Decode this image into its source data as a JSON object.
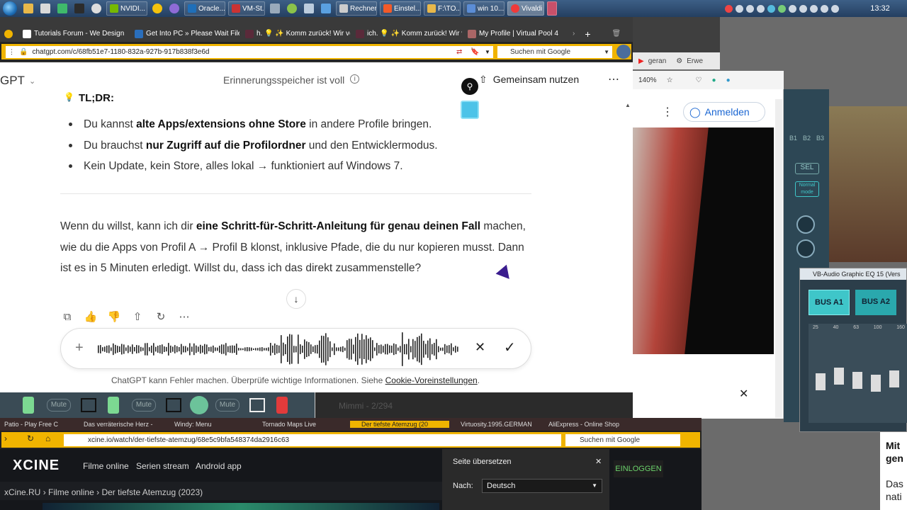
{
  "taskbar": {
    "tasks": [
      "NVIDI...",
      "Oracle...",
      "VM-St...",
      "Rechner",
      "Einstel...",
      "F:\\TO...",
      "win 10...",
      "Vivaldi"
    ],
    "clock": "13:32"
  },
  "main_tabs": [
    "Tutorials Forum - We Design",
    "Get Into PC » Please Wait File",
    "h. 💡 ✨ Komm zurück! Wir ver",
    "ich. 💡 ✨ Komm zurück! Wir v",
    "My Profile | Virtual Pool 4"
  ],
  "address": {
    "url": "chatgpt.com/c/68fb51e7-1180-832a-927b-917b838f3e6d",
    "search_placeholder": "Suchen mit Google"
  },
  "chat": {
    "model": "GPT",
    "memory_notice": "Erinnerungsspeicher ist voll",
    "share_label": "Gemeinsam nutzen",
    "tldr": "TL;DR:",
    "bullets": [
      {
        "pre": "Du kannst ",
        "bold": "alte Apps/extensions ohne Store",
        "post": " in andere Profile bringen."
      },
      {
        "pre": "Du brauchst ",
        "bold": "nur Zugriff auf die Profilordner",
        "post": " und den Entwicklermodus."
      },
      {
        "pre": "Kein Update, kein Store, alles lokal → funktioniert auf Windows 7.",
        "bold": "",
        "post": ""
      }
    ],
    "para_pre": "Wenn du willst, kann ich dir ",
    "para_bold": "eine Schritt-für-Schritt-Anleitung für genau deinen Fall",
    "para_post": " machen, wie du die Apps von Profil A → Profil B klonst, inklusive Pfade, die du nur kopieren musst. Dann ist es in 5 Minuten erledigt. Willst du, dass ich das direkt zusammenstelle?",
    "footer_text": "ChatGPT kann Fehler machen. Überprüfe wichtige Informationen. Siehe ",
    "footer_link": "Cookie-Voreinstellungen",
    "footer_end": "."
  },
  "right": {
    "tab1": "geran",
    "tab2": "Erwe",
    "zoom": "140%",
    "signin": "Anmelden",
    "eq_title": "VB-Audio Graphic EQ 15 (Vers",
    "bus_a1": "BUS A1",
    "bus_a2": "BUS A2",
    "sel": "SEL",
    "normal_mode": "Normal mode",
    "comment": "Mimmi - 2/294",
    "b_labels": [
      "B1",
      "B2",
      "B3"
    ],
    "eq_freqs": [
      "25",
      "40",
      "63",
      "100",
      "160"
    ],
    "side_text": [
      "Mit",
      "gen",
      "Das",
      "nati"
    ]
  },
  "mute_labels": [
    "Mute",
    "Mute",
    "Mute"
  ],
  "bottom": {
    "tabs": [
      "Patio - Play Free C",
      "Das verräterische Herz -",
      "Windy: Menu",
      "Tornado Maps Live",
      "Der tiefste Atemzug (20",
      "Virtuosity.1995.GERMAN",
      "AliExpress - Online Shop"
    ],
    "url": "xcine.io/watch/der-tiefste-atemzug/68e5c9bfa548374da2916c63",
    "search": "Suchen mit Google",
    "logo": "XCINE",
    "nav": [
      "Filme online",
      "Serien stream",
      "Android app"
    ],
    "login": "EINLOGGEN",
    "breadcrumb": [
      "xCine.RU",
      "Filme online",
      "Der tiefste Atemzug (2023)"
    ],
    "translate_title": "Seite übersetzen",
    "translate_to_label": "Nach:",
    "translate_lang": "Deutsch"
  },
  "colors": {
    "accent": "#f0b400",
    "vivaldi": "#ef3939",
    "eq_teal": "#3fc6c9"
  }
}
